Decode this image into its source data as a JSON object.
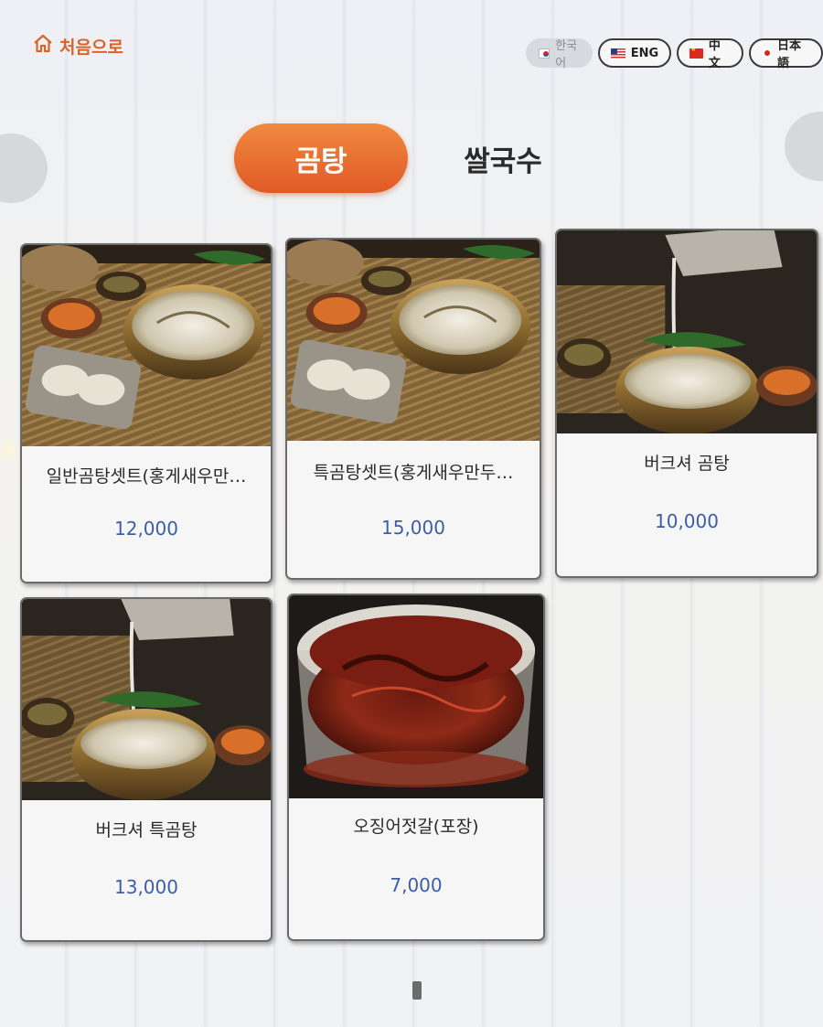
{
  "header": {
    "home_label": "처음으로",
    "home_icon": "house-icon"
  },
  "languages": [
    {
      "label": "한국어",
      "flag": "korea-flag-icon",
      "active": true
    },
    {
      "label": "ENG",
      "flag": "usa-flag-icon",
      "active": false
    },
    {
      "label": "中文",
      "flag": "china-flag-icon",
      "active": false
    },
    {
      "label": "日本語",
      "flag": "japan-flag-icon",
      "active": false
    }
  ],
  "tabs": [
    {
      "label": "곰탕",
      "active": true
    },
    {
      "label": "쌀국수",
      "active": false
    }
  ],
  "menu": [
    {
      "name": "일반곰탕셋트(홍게새우만…",
      "price": "12,000",
      "image": "gomtang-set-with-dumplings"
    },
    {
      "name": "특곰탕셋트(홍게새우만두…",
      "price": "15,000",
      "image": "gomtang-set-with-dumplings"
    },
    {
      "name": "버크셔 곰탕",
      "price": "10,000",
      "image": "gomtang-broth-pouring"
    },
    {
      "name": "버크셔 특곰탕",
      "price": "13,000",
      "image": "gomtang-broth-pouring"
    },
    {
      "name": "오징어젓갈(포장)",
      "price": "7,000",
      "image": "squid-jeotgal-container"
    }
  ],
  "pagination": {
    "current": 1,
    "total": 1
  },
  "colors": {
    "accent": "#e0652a",
    "price": "#3c5ea8"
  }
}
